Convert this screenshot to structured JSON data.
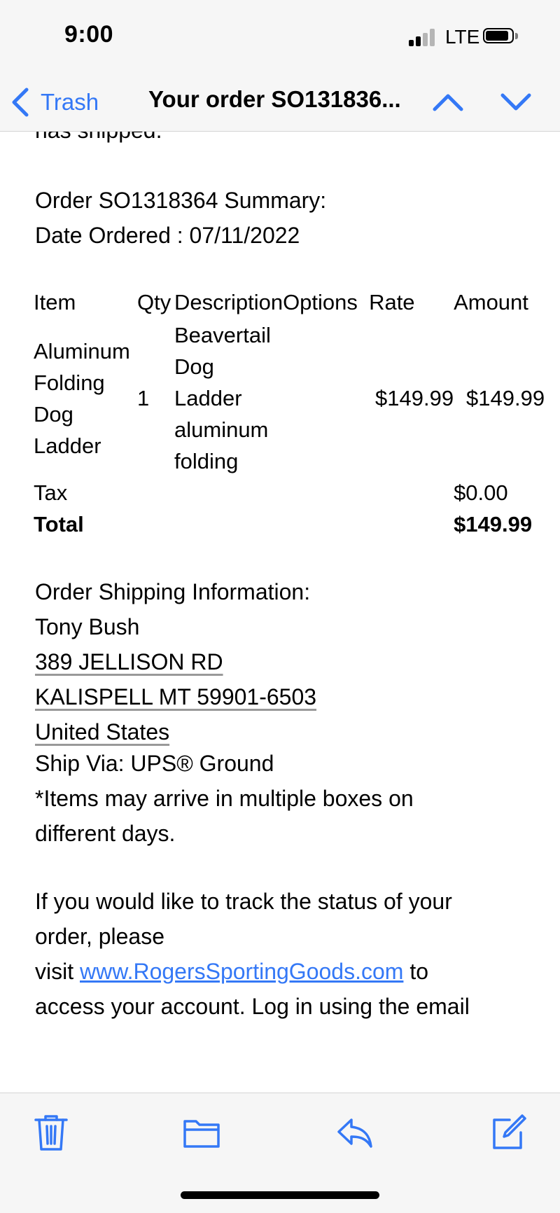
{
  "status": {
    "time": "9:00",
    "network": "LTE"
  },
  "nav": {
    "back_label": "Trash",
    "title": "Your order SO131836..."
  },
  "email": {
    "clipped_line": "has shipped.",
    "summary_line1": "Order SO1318364 Summary:",
    "summary_line2": "Date Ordered : 07/11/2022",
    "table": {
      "headers": {
        "item": "Item",
        "qty": "Qty",
        "description": "Description",
        "options": "Options",
        "rate": "Rate",
        "amount": "Amount"
      },
      "row": {
        "item": "Aluminum Folding Dog Ladder",
        "qty": "1",
        "description": "Beavertail Dog Ladder aluminum folding",
        "options": "",
        "rate": "$149.99",
        "amount": "$149.99"
      },
      "tax_label": "Tax",
      "tax_value": "$0.00",
      "total_label": "Total",
      "total_value": "$149.99"
    },
    "shipping": {
      "heading": "Order Shipping Information:",
      "name": "Tony Bush",
      "street": "389 JELLISON RD",
      "city": "KALISPELL MT 59901-6503",
      "country": "United States"
    },
    "ship_via": "Ship Via: UPS® Ground",
    "note_line1": "*Items may arrive in multiple boxes on",
    "note_line2": "different days.",
    "track_line1": "If you would like to track the status of your",
    "track_line2": "order, please",
    "track_visit": "visit ",
    "track_link": "www.RogersSportingGoods.com",
    "track_after": " to",
    "track_line4": "access your account. Log in using the email"
  },
  "toolbar": {
    "icons": [
      "trash-icon",
      "folder-icon",
      "reply-icon",
      "compose-icon"
    ]
  },
  "colors": {
    "accent": "#3478f6",
    "bar_bg": "#f6f6f6"
  }
}
